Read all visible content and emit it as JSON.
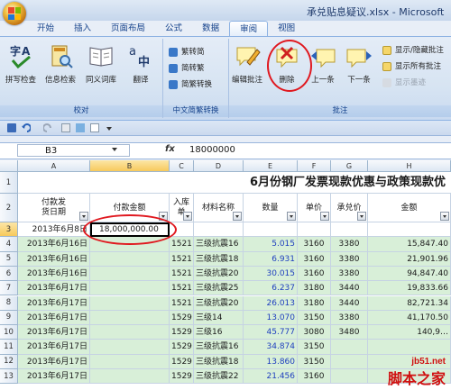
{
  "window": {
    "title": "承兑贴息疑议.xlsx - Microsoft"
  },
  "ribbon_tabs": [
    "开始",
    "插入",
    "页面布局",
    "公式",
    "数据",
    "审阅",
    "视图"
  ],
  "active_tab": "审阅",
  "groups": {
    "proofing": {
      "label": "校对",
      "buttons": [
        "拼写检查",
        "信息检索",
        "同义词库",
        "翻译"
      ]
    },
    "chinese_conversion": {
      "label": "中文简繁转换",
      "buttons": [
        "繁转简",
        "简转繁",
        "简繁转换"
      ]
    },
    "comments": {
      "label": "批注",
      "big_buttons": [
        "编辑批注",
        "删除",
        "上一条",
        "下一条"
      ],
      "small_buttons": [
        "显示/隐藏批注",
        "显示所有批注",
        "显示墨迹"
      ]
    }
  },
  "name_box": "B3",
  "fx_label": "fx",
  "formula": "18000000",
  "columns": [
    "A",
    "B",
    "C",
    "D",
    "E",
    "F",
    "G",
    "H"
  ],
  "sheet_title": "6月份钢厂发票现款优惠与政策现款优",
  "headers": {
    "A": "付款发\n货日期",
    "B": "付款金额",
    "C": "入库\n单",
    "D": "材料名称",
    "E": "数量",
    "F": "单价",
    "G": "承兑价",
    "H": "金额"
  },
  "rows": [
    {
      "row": "3",
      "A": "2013年6月8日",
      "B": "18,000,000.00",
      "C": "",
      "D": "",
      "E": "",
      "F": "",
      "G": "",
      "H": ""
    },
    {
      "row": "4",
      "A": "2013年6月16日",
      "B": "",
      "C": "1521",
      "D": "三级抗震16",
      "E": "5.015",
      "F": "3160",
      "G": "3380",
      "H": "15,847.40"
    },
    {
      "row": "5",
      "A": "2013年6月16日",
      "B": "",
      "C": "1521",
      "D": "三级抗震18",
      "E": "6.931",
      "F": "3160",
      "G": "3380",
      "H": "21,901.96"
    },
    {
      "row": "6",
      "A": "2013年6月16日",
      "B": "",
      "C": "1521",
      "D": "三级抗震20",
      "E": "30.015",
      "F": "3160",
      "G": "3380",
      "H": "94,847.40"
    },
    {
      "row": "7",
      "A": "2013年6月17日",
      "B": "",
      "C": "1521",
      "D": "三级抗震25",
      "E": "6.237",
      "F": "3180",
      "G": "3440",
      "H": "19,833.66"
    },
    {
      "row": "8",
      "A": "2013年6月17日",
      "B": "",
      "C": "1521",
      "D": "三级抗震20",
      "E": "26.013",
      "F": "3180",
      "G": "3440",
      "H": "82,721.34"
    },
    {
      "row": "9",
      "A": "2013年6月17日",
      "B": "",
      "C": "1529",
      "D": "三级14",
      "E": "13.070",
      "F": "3150",
      "G": "3380",
      "H": "41,170.50"
    },
    {
      "row": "10",
      "A": "2013年6月17日",
      "B": "",
      "C": "1529",
      "D": "三级16",
      "E": "45.777",
      "F": "3080",
      "G": "3480",
      "H": "140,9…"
    },
    {
      "row": "11",
      "A": "2013年6月17日",
      "B": "",
      "C": "1529",
      "D": "三级抗震16",
      "E": "34.874",
      "F": "3150",
      "G": "",
      "H": ""
    },
    {
      "row": "12",
      "A": "2013年6月17日",
      "B": "",
      "C": "1529",
      "D": "三级抗震18",
      "E": "13.860",
      "F": "3150",
      "G": "",
      "H": ""
    },
    {
      "row": "13",
      "A": "2013年6月17日",
      "B": "",
      "C": "1529",
      "D": "三级抗震22",
      "E": "21.456",
      "F": "3160",
      "G": "",
      "H": ""
    }
  ],
  "watermark": {
    "line1": "jb51.net",
    "line2": "脚本之家"
  },
  "colors": {
    "annotation": "#e0181f",
    "green_rows": "#d8efd8",
    "ribbon_blue": "#15428b"
  }
}
